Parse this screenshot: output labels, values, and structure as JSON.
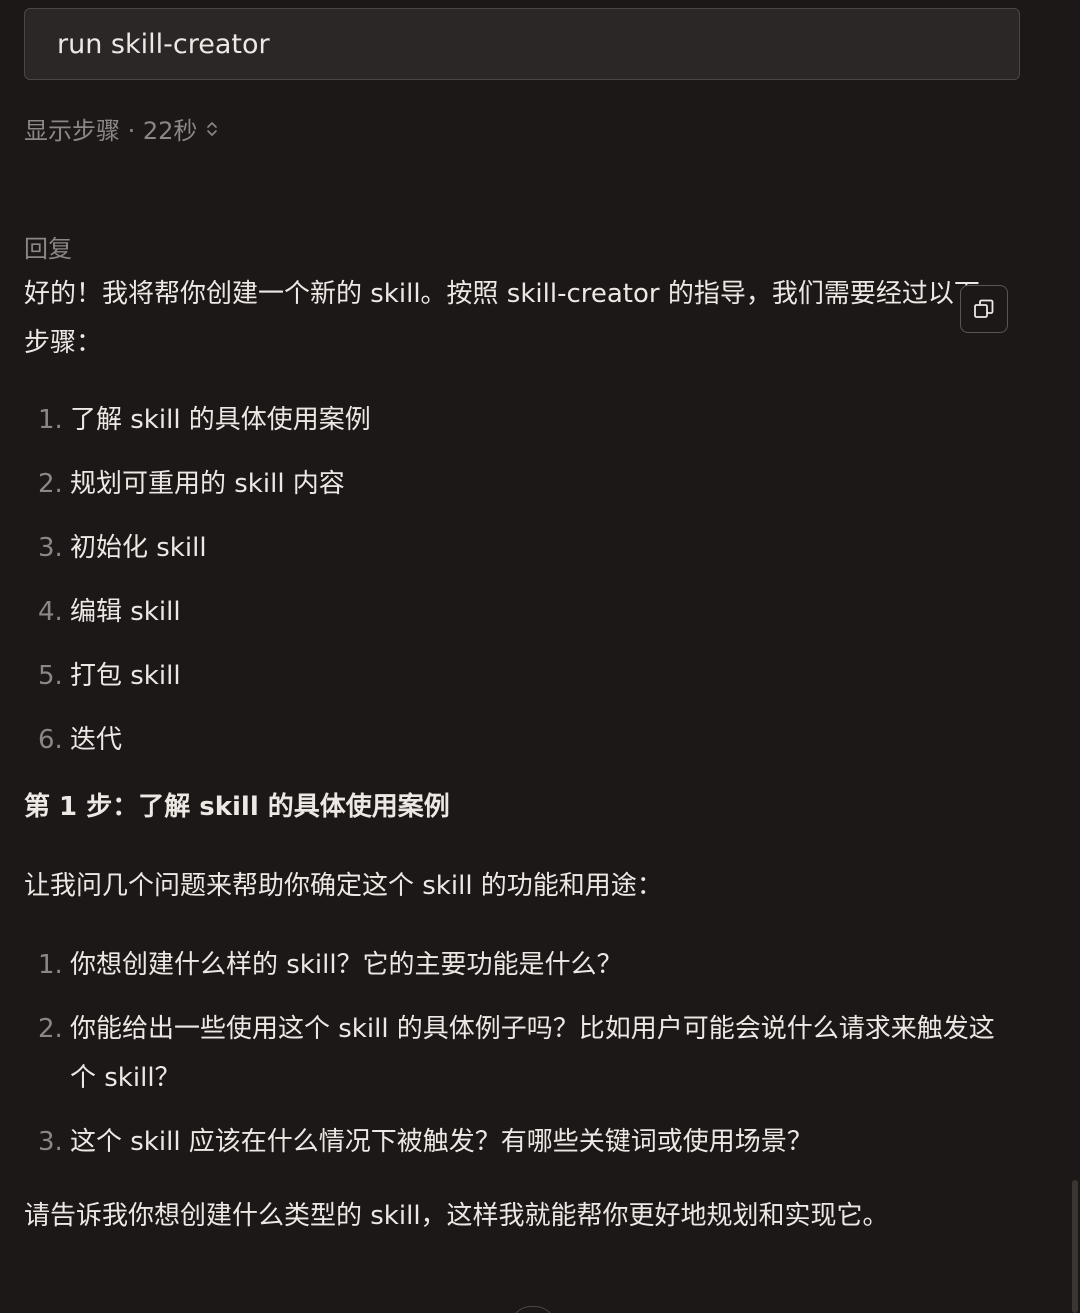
{
  "prompt": {
    "text": "run skill-creator"
  },
  "steps_toggle": {
    "label": "显示步骤 · 22秒",
    "icon": "chevron-up-down-icon"
  },
  "reply": {
    "label": "回复",
    "intro": "好的！我将帮你创建一个新的 skill。按照 skill-creator 的指导，我们需要经过以下步骤：",
    "steps": [
      {
        "num": "1.",
        "text": "了解 skill 的具体使用案例"
      },
      {
        "num": "2.",
        "text": "规划可重用的 skill 内容"
      },
      {
        "num": "3.",
        "text": "初始化 skill"
      },
      {
        "num": "4.",
        "text": "编辑 skill"
      },
      {
        "num": "5.",
        "text": "打包 skill"
      },
      {
        "num": "6.",
        "text": "迭代"
      }
    ],
    "heading": "第 1 步：了解 skill 的具体使用案例",
    "ask": "让我问几个问题来帮助你确定这个 skill 的功能和用途：",
    "questions": [
      {
        "num": "1.",
        "text": "你想创建什么样的 skill？它的主要功能是什么？"
      },
      {
        "num": "2.",
        "text": "你能给出一些使用这个 skill 的具体例子吗？比如用户可能会说什么请求来触发这个 skill？"
      },
      {
        "num": "3.",
        "text": "这个 skill 应该在什么情况下被触发？有哪些关键词或使用场景？"
      }
    ],
    "closing": "请告诉我你想创建什么类型的 skill，这样我就能帮你更好地规划和实现它。"
  },
  "copy_button": {
    "icon": "copy-icon"
  }
}
